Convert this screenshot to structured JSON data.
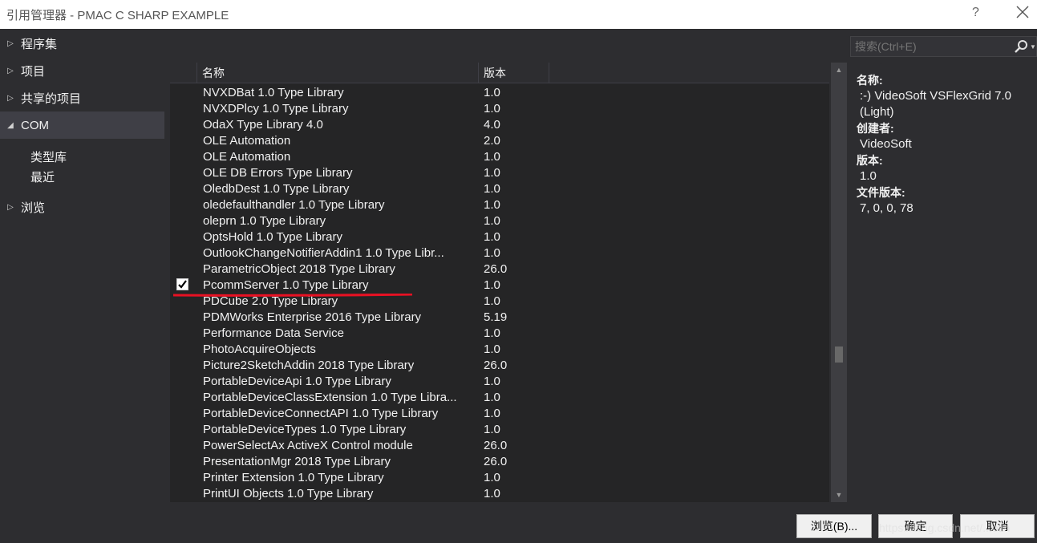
{
  "window": {
    "title": "引用管理器 - PMAC C SHARP EXAMPLE",
    "help_label": "?"
  },
  "nav": {
    "items": [
      {
        "label": "程序集",
        "arrow": "▷"
      },
      {
        "label": "项目",
        "arrow": "▷"
      },
      {
        "label": "共享的项目",
        "arrow": "▷"
      },
      {
        "label": "COM",
        "arrow": "◢"
      },
      {
        "label": "浏览",
        "arrow": "▷"
      }
    ],
    "sub_items": [
      "类型库",
      "最近"
    ]
  },
  "table": {
    "headers": {
      "name": "名称",
      "version": "版本"
    },
    "rows": [
      {
        "name": "NVXDBat 1.0 Type Library",
        "version": "1.0",
        "checked": false
      },
      {
        "name": "NVXDPlcy 1.0 Type Library",
        "version": "1.0",
        "checked": false
      },
      {
        "name": "OdaX Type Library 4.0",
        "version": "4.0",
        "checked": false
      },
      {
        "name": "OLE Automation",
        "version": "2.0",
        "checked": false
      },
      {
        "name": "OLE Automation",
        "version": "1.0",
        "checked": false
      },
      {
        "name": "OLE DB Errors Type Library",
        "version": "1.0",
        "checked": false
      },
      {
        "name": "OledbDest 1.0 Type Library",
        "version": "1.0",
        "checked": false
      },
      {
        "name": "oledefaulthandler 1.0 Type Library",
        "version": "1.0",
        "checked": false
      },
      {
        "name": "oleprn 1.0 Type Library",
        "version": "1.0",
        "checked": false
      },
      {
        "name": "OptsHold 1.0 Type Library",
        "version": "1.0",
        "checked": false
      },
      {
        "name": "OutlookChangeNotifierAddin1 1.0 Type Libr...",
        "version": "1.0",
        "checked": false
      },
      {
        "name": "ParametricObject 2018 Type Library",
        "version": "26.0",
        "checked": false
      },
      {
        "name": "PcommServer 1.0 Type Library",
        "version": "1.0",
        "checked": true
      },
      {
        "name": "PDCube 2.0 Type Library",
        "version": "1.0",
        "checked": false
      },
      {
        "name": "PDMWorks Enterprise 2016 Type Library",
        "version": "5.19",
        "checked": false
      },
      {
        "name": "Performance Data Service",
        "version": "1.0",
        "checked": false
      },
      {
        "name": "PhotoAcquireObjects",
        "version": "1.0",
        "checked": false
      },
      {
        "name": "Picture2SketchAddin 2018 Type Library",
        "version": "26.0",
        "checked": false
      },
      {
        "name": "PortableDeviceApi 1.0 Type Library",
        "version": "1.0",
        "checked": false
      },
      {
        "name": "PortableDeviceClassExtension 1.0 Type Libra...",
        "version": "1.0",
        "checked": false
      },
      {
        "name": "PortableDeviceConnectAPI 1.0 Type Library",
        "version": "1.0",
        "checked": false
      },
      {
        "name": "PortableDeviceTypes 1.0 Type Library",
        "version": "1.0",
        "checked": false
      },
      {
        "name": "PowerSelectAx ActiveX Control module",
        "version": "26.0",
        "checked": false
      },
      {
        "name": "PresentationMgr 2018 Type Library",
        "version": "26.0",
        "checked": false
      },
      {
        "name": "Printer Extension 1.0 Type Library",
        "version": "1.0",
        "checked": false
      },
      {
        "name": "PrintUI Objects 1.0 Type Library",
        "version": "1.0",
        "checked": false
      }
    ]
  },
  "search": {
    "placeholder": "搜索(Ctrl+E)"
  },
  "details": {
    "name_label": "名称:",
    "name_value": ":-) VideoSoft VSFlexGrid 7.0 (Light)",
    "creator_label": "创建者:",
    "creator_value": "VideoSoft",
    "version_label": "版本:",
    "version_value": "1.0",
    "file_version_label": "文件版本:",
    "file_version_value": "7, 0, 0, 78"
  },
  "footer": {
    "browse_label": "浏览(B)...",
    "ok_label": "确定",
    "cancel_label": "取消"
  },
  "watermark": "https://blog.csdn.net/...otin",
  "colors": {
    "background": "#2d2d30",
    "list_background": "#252526",
    "highlight_underline": "#e81123"
  }
}
